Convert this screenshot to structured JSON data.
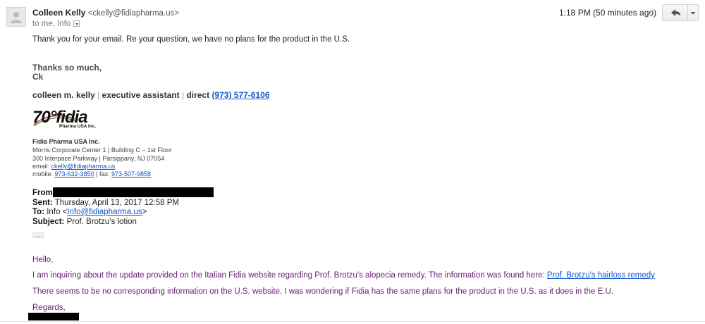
{
  "header": {
    "sender_name": "Colleen Kelly",
    "sender_email": "<ckelly@fidiapharma.us>",
    "to_line": "to me, Info",
    "timestamp": "1:18 PM (50 minutes ago)",
    "star_icon": "star-outline-icon",
    "reply_icon": "reply-arrow-icon",
    "more_icon": "chevron-down-icon"
  },
  "body": {
    "line1": "Thank you for your email.  Re your question, we have no plans for the product in the U.S.",
    "closing1": "Thanks so much,",
    "closing2": "Ck"
  },
  "signature": {
    "name": "colleen m. kelly",
    "sep": "|",
    "title": "executive assistant",
    "direct_label": "direct",
    "phone": "(973) 577-6106",
    "logo_text": "70°fidia",
    "logo_sub": "Pharma USA Inc.",
    "company": "Fidia Pharma USA Inc.",
    "address1": "Morris Corporate Center 1 | Building C – 1st Floor",
    "address2": "300 Interpace Parkway | Parsippany, NJ  07054",
    "email_label": "email:",
    "email": "ckelly@fidiapharma.us",
    "mobile_label": "mobile:",
    "mobile": "973-632-3850",
    "fax_label": "| fax:",
    "fax": "973-507-9858"
  },
  "forwarded": {
    "from_label": "From:",
    "sent_label": "Sent:",
    "sent_value": "Thursday, April 13, 2017 12:58 PM",
    "to_label": "To:",
    "to_value": "Info <",
    "to_link": "Info@fidiapharma.us",
    "to_end": ">",
    "subject_label": "Subject:",
    "subject_value": "Prof. Brotzu's lotion",
    "ellipsis": "..."
  },
  "quoted": {
    "greeting": "Hello,",
    "para1": "I am inquiring about the update provided on the Italian Fidia website regarding Prof. Brotzu's alopecia remedy. The information was found here: ",
    "para1_link": "Prof. Brotzu's hairloss remedy",
    "para2": "There seems to be no corresponding information on the U.S. website. I was wondering if Fidia has the same plans for the product in the U.S. as it does in the E.U.",
    "regards": "Regards,"
  }
}
